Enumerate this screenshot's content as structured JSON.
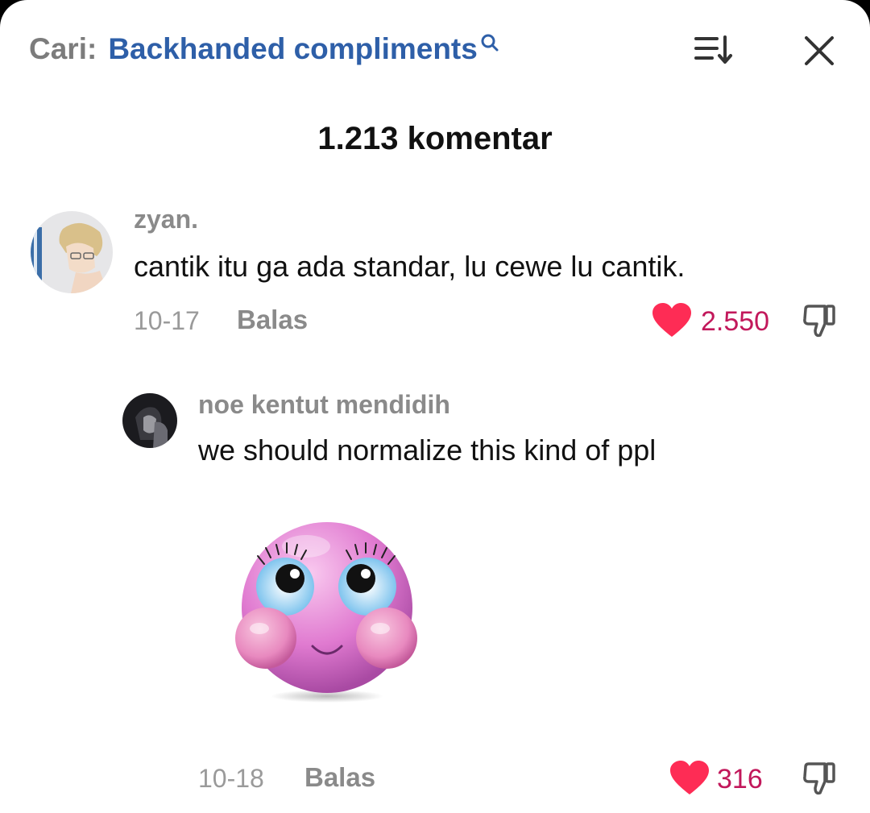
{
  "header": {
    "search_prefix": "Cari:",
    "search_query": "Backhanded compliments",
    "comment_count": "1.213 komentar"
  },
  "comments": [
    {
      "username": "zyan.",
      "text": "cantik itu ga ada standar, lu cewe lu cantik.",
      "date": "10-17",
      "reply_label": "Balas",
      "likes": "2.550",
      "liked": true
    },
    {
      "username": "noe kentut mendidih",
      "text": "we should normalize this kind of ppl",
      "date": "10-18",
      "reply_label": "Balas",
      "likes": "316",
      "liked": true
    }
  ],
  "colors": {
    "accent_blue": "#2e5fa8",
    "like_red": "#fe2c55",
    "like_count": "#c2185b",
    "muted_text": "#8a8a8a"
  },
  "icons": [
    "search-icon",
    "sort-icon",
    "close-icon",
    "heart-icon",
    "thumbs-down-icon",
    "blushing-emoji-sticker"
  ]
}
